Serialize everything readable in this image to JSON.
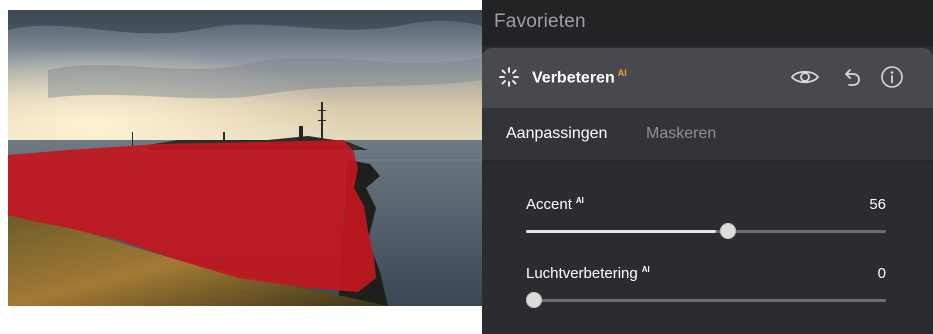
{
  "panel": {
    "section_title": "Favorieten",
    "tool": {
      "title": "Verbeteren",
      "ai_badge": "AI",
      "icon": "sparkle-icon",
      "accent_color": "#f0a43b",
      "actions": [
        {
          "name": "eye-icon"
        },
        {
          "name": "undo-icon"
        },
        {
          "name": "info-icon"
        }
      ]
    },
    "tabs": [
      {
        "label": "Aanpassingen",
        "active": true
      },
      {
        "label": "Maskeren",
        "active": false
      }
    ],
    "sliders": [
      {
        "label": "Accent",
        "ai": "AI",
        "value": "56",
        "level": 0.56
      },
      {
        "label": "Luchtverbetering",
        "ai": "AI",
        "value": "0",
        "level": 0.0
      }
    ]
  },
  "photo": {
    "mask_color": "#c3171f",
    "subject": "coastal cliff with mask overlay"
  }
}
